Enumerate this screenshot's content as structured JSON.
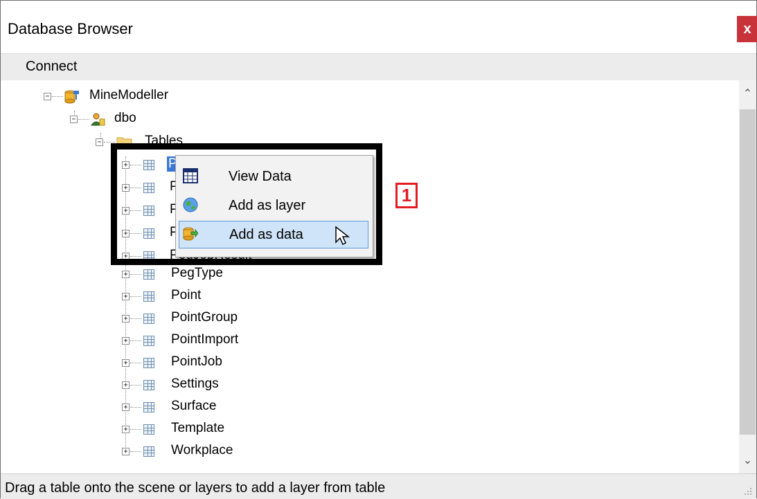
{
  "window": {
    "title": "Database Browser",
    "close_label": "x"
  },
  "menu": {
    "connect": "Connect"
  },
  "tree": {
    "database": "MineModeller",
    "schema": "dbo",
    "folder": "Tables",
    "partial_items": [
      "P",
      "P",
      "P",
      "P"
    ],
    "selected_item": "P",
    "obscured_item": "PegJobResult",
    "tables": [
      "PegType",
      "Point",
      "PointGroup",
      "PointImport",
      "PointJob",
      "Settings",
      "Surface",
      "Template",
      "Workplace"
    ]
  },
  "context_menu": {
    "items": [
      {
        "label": "View Data",
        "icon": "grid-table-icon"
      },
      {
        "label": "Add as layer",
        "icon": "globe-icon"
      },
      {
        "label": "Add as data",
        "icon": "database-arrow-icon",
        "hovered": true
      }
    ]
  },
  "annotation": {
    "callout": "1"
  },
  "status": {
    "text": "Drag a table onto the scene or layers to add a layer from table"
  },
  "colors": {
    "close_button": "#c8333a",
    "selection": "#3a77d6",
    "callout": "#e31b23",
    "menu_hover": "#cfe4f8"
  }
}
